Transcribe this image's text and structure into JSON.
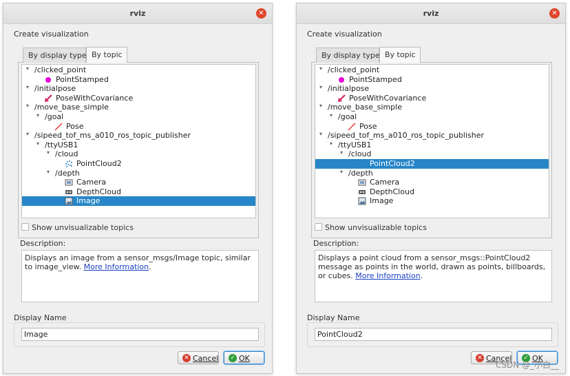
{
  "dialogs": [
    {
      "title": "rviz",
      "create_label": "Create visualization",
      "tabs": [
        "By display type",
        "By topic"
      ],
      "tree": [
        {
          "indent": 0,
          "arrow": "▾",
          "text": "/clicked_point",
          "icon": ""
        },
        {
          "indent": 2,
          "arrow": "",
          "text": "PointStamped",
          "icon": "magenta-point-icon"
        },
        {
          "indent": 0,
          "arrow": "▾",
          "text": "/initialpose",
          "icon": ""
        },
        {
          "indent": 2,
          "arrow": "",
          "text": "PoseWithCovariance",
          "icon": "pose-covariance-arrow-icon"
        },
        {
          "indent": 0,
          "arrow": "▾",
          "text": "/move_base_simple",
          "icon": ""
        },
        {
          "indent": 1,
          "arrow": "▾",
          "text": "/goal",
          "icon": ""
        },
        {
          "indent": 3,
          "arrow": "",
          "text": "Pose",
          "icon": "pose-arrow-icon"
        },
        {
          "indent": 0,
          "arrow": "▾",
          "text": "/sipeed_tof_ms_a010_ros_topic_publisher",
          "icon": ""
        },
        {
          "indent": 1,
          "arrow": "▾",
          "text": "/ttyUSB1",
          "icon": ""
        },
        {
          "indent": 2,
          "arrow": "▾",
          "text": "/cloud",
          "icon": ""
        },
        {
          "indent": 4,
          "arrow": "",
          "text": "PointCloud2",
          "icon": "point-cloud-icon"
        },
        {
          "indent": 2,
          "arrow": "▾",
          "text": "/depth",
          "icon": ""
        },
        {
          "indent": 4,
          "arrow": "",
          "text": "Camera",
          "icon": "camera-icon"
        },
        {
          "indent": 4,
          "arrow": "",
          "text": "DepthCloud",
          "icon": "depth-cloud-icon"
        },
        {
          "indent": 4,
          "arrow": "",
          "text": "Image",
          "icon": "image-icon"
        }
      ],
      "selected_index": 14,
      "show_unvisualizable": "Show unvisualizable topics",
      "description_label": "Description:",
      "description_text": "Displays an image from a sensor_msgs/Image topic, similar to image_view. ",
      "description_link": "More Information",
      "description_tail": ".",
      "display_name_label": "Display Name",
      "display_name_value": "Image",
      "cancel_label": "Cancel",
      "ok_label": "OK"
    },
    {
      "title": "rviz",
      "create_label": "Create visualization",
      "tabs": [
        "By display type",
        "By topic"
      ],
      "tree": [
        {
          "indent": 0,
          "arrow": "▾",
          "text": "/clicked_point",
          "icon": ""
        },
        {
          "indent": 2,
          "arrow": "",
          "text": "PointStamped",
          "icon": "magenta-point-icon"
        },
        {
          "indent": 0,
          "arrow": "▾",
          "text": "/initialpose",
          "icon": ""
        },
        {
          "indent": 2,
          "arrow": "",
          "text": "PoseWithCovariance",
          "icon": "pose-covariance-arrow-icon"
        },
        {
          "indent": 0,
          "arrow": "▾",
          "text": "/move_base_simple",
          "icon": ""
        },
        {
          "indent": 1,
          "arrow": "▾",
          "text": "/goal",
          "icon": ""
        },
        {
          "indent": 3,
          "arrow": "",
          "text": "Pose",
          "icon": "pose-arrow-icon"
        },
        {
          "indent": 0,
          "arrow": "▾",
          "text": "/sipeed_tof_ms_a010_ros_topic_publisher",
          "icon": ""
        },
        {
          "indent": 1,
          "arrow": "▾",
          "text": "/ttyUSB1",
          "icon": ""
        },
        {
          "indent": 2,
          "arrow": "▾",
          "text": "/cloud",
          "icon": ""
        },
        {
          "indent": 4,
          "arrow": "",
          "text": "PointCloud2",
          "icon": "point-cloud-icon"
        },
        {
          "indent": 2,
          "arrow": "▾",
          "text": "/depth",
          "icon": ""
        },
        {
          "indent": 4,
          "arrow": "",
          "text": "Camera",
          "icon": "camera-icon"
        },
        {
          "indent": 4,
          "arrow": "",
          "text": "DepthCloud",
          "icon": "depth-cloud-icon"
        },
        {
          "indent": 4,
          "arrow": "",
          "text": "Image",
          "icon": "image-icon"
        }
      ],
      "selected_index": 10,
      "show_unvisualizable": "Show unvisualizable topics",
      "description_label": "Description:",
      "description_text": "Displays a point cloud from a sensor_msgs::PointCloud2 message as points in the world, drawn as points, billboards, or cubes. ",
      "description_link": "More Information",
      "description_tail": ".",
      "display_name_label": "Display Name",
      "display_name_value": "PointCloud2",
      "cancel_label": "Cancel",
      "ok_label": "OK"
    }
  ],
  "watermark": "CSDN @_小白__",
  "colors": {
    "selection": "#2786c8",
    "link": "#1a3fc4",
    "close": "#e0452c"
  }
}
